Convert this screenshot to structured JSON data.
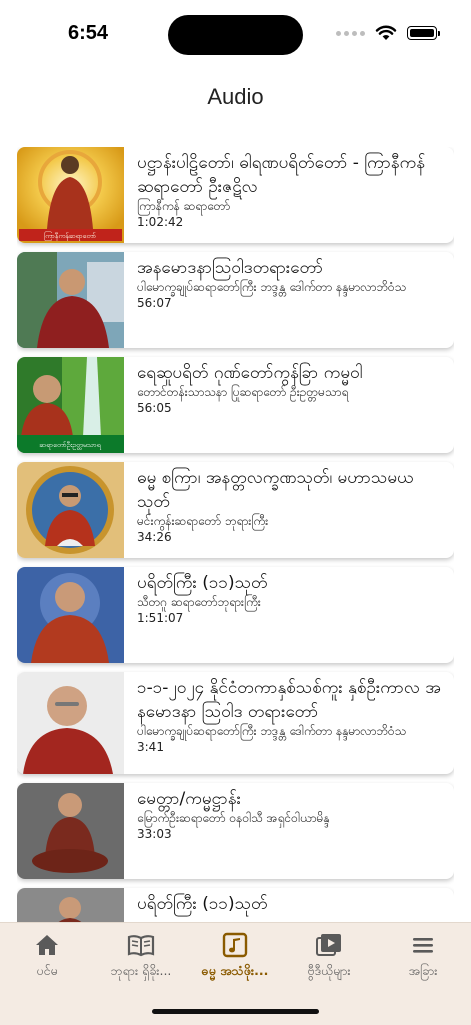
{
  "status_bar": {
    "time": "6:54"
  },
  "header": {
    "title": "Audio"
  },
  "audio_list": [
    {
      "title": "ပဋ္ဌာန်းပါဠိတော်၊ ဓါရဏပရိတ်တော် - ကြာနီကန်ဆရာတော် ဦးဇဋိလ",
      "speaker": "ကြာနီကန် ဆရာတော်",
      "duration": "1:02:42",
      "thumb": "monk-golden-halo",
      "thumb_caption": "ကြာနီကန်ဆရာတော်"
    },
    {
      "title": "အနမောဒနာသြဝါဒတရားတော်",
      "speaker": "ပါမောက္ခချုပ်ဆရာတော်ကြီး ဘဒ္ဒန္တ ဒေါက်တာ နန္ဒမာလာဘိဝံသ",
      "duration": "56:07",
      "thumb": "monk-seated-photo"
    },
    {
      "title": "ရေဆူပရိတ် ဂုဏ်တော်ကွန်ခြာ ကမ္မဝါ",
      "speaker": "တောင်တန်းသာသနာ ပြုဆရာတော်  ဦးဥတ္တမသာရ",
      "duration": "56:05",
      "thumb": "monk-waterfall",
      "thumb_caption": "ဆရာတော်ဦးဥတ္တမသာရ"
    },
    {
      "title": "ဓမ္မ စကြာ၊ အနတ္တလက္ခဏသုတ်၊ မဟာသမယသုတ်",
      "speaker": "မင်းကွန်းဆရာတော် ဘုရားကြီး",
      "duration": "34:26",
      "thumb": "monk-gold-frame"
    },
    {
      "title": "ပရိတ်ကြီး (၁၁)သုတ်",
      "speaker": "သီတဂူ ဆရာတော်ဘုရားကြီး",
      "duration": "1:51:07",
      "thumb": "monk-blue-bg"
    },
    {
      "title": "၁-၁-၂၀၂၄ နိုင်ငံတကာနှစ်သစ်ကူး နှစ်ဦးကာလ အနမောဒနာ သြဝါဒ တရားတော်",
      "speaker": "ပါမောက္ခချုပ်ဆရာတော်ကြီး ဘဒ္ဒန္တ ဒေါက်တာ နန္ဒမာလာဘိဝံသ",
      "duration": "3:41",
      "thumb": "monk-smiling"
    },
    {
      "title": "မေတ္တာ/ကမ္မဋ္ဌာန်း",
      "speaker": "မြောက်ဦးဆရာတော် ဝနဝါသီ အရှင်ဝါယာမိန္ဒ",
      "duration": "33:03",
      "thumb": "monk-meditating"
    },
    {
      "title": "ပရိတ်ကြီး (၁၁)သုတ်",
      "speaker": "",
      "duration": "",
      "thumb": "monk-grey-bg"
    }
  ],
  "tab_bar": {
    "items": [
      {
        "label": "ပင်မ",
        "icon": "home-icon"
      },
      {
        "label": "ဘုရား ရှိခိုး...",
        "icon": "book-icon"
      },
      {
        "label": "ဓမ္မ အသံဖိုး...",
        "icon": "music-note-icon"
      },
      {
        "label": "ဗွီဒီယိုများ",
        "icon": "video-icon"
      },
      {
        "label": "အခြား",
        "icon": "menu-icon"
      }
    ],
    "active_index": 2,
    "colors": {
      "active": "#8a5a00",
      "inactive": "#5a5a5a"
    }
  }
}
